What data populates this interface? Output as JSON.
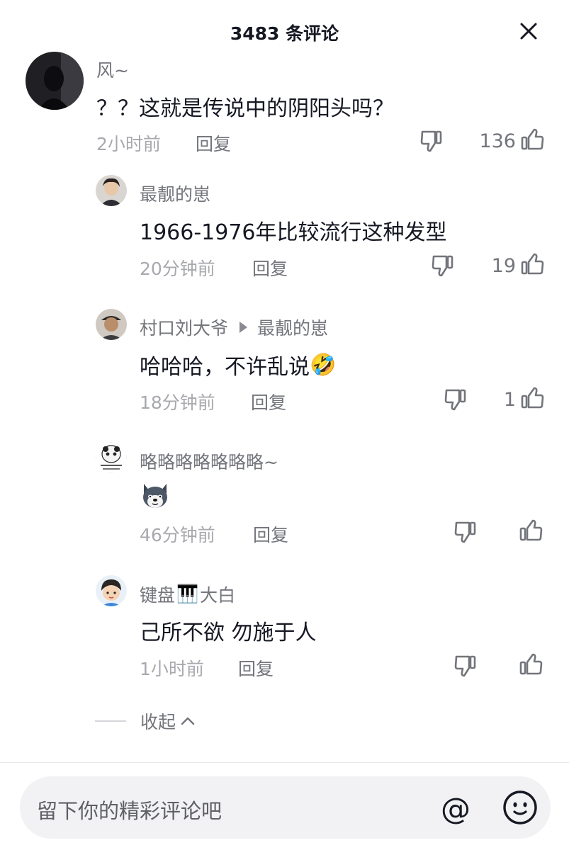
{
  "header": {
    "title": "3483 条评论",
    "close_icon": "close-icon"
  },
  "comments": [
    {
      "author": "风~",
      "text": "？？这就是传说中的阴阳头吗？",
      "time": "2小时前",
      "reply": "回复",
      "likes": "136"
    },
    {
      "author": "最靓的崽",
      "text": "1966-1976年比较流行这种发型",
      "time": "20分钟前",
      "reply": "回复",
      "likes": "19"
    },
    {
      "author": "村口刘大爷",
      "reply_to": "最靓的崽",
      "text": "哈哈哈，不许乱说",
      "emoji": "🤣",
      "time": "18分钟前",
      "reply": "回复",
      "likes": "1"
    },
    {
      "author": "略略略略略略略~",
      "text": "",
      "sticker": "dog-face-sticker",
      "time": "46分钟前",
      "reply": "回复",
      "likes": ""
    },
    {
      "author_part1": "键盘",
      "author_part2": "大白",
      "author_emoji": "🎹",
      "text": "己所不欲 勿施于人",
      "time": "1小时前",
      "reply": "回复",
      "likes": ""
    }
  ],
  "collapse": {
    "label": "收起"
  },
  "input": {
    "placeholder": "留下你的精彩评论吧",
    "at_icon": "at-icon",
    "at_symbol": "@",
    "emoji_icon": "emoji-icon"
  },
  "colors": {
    "text": "#161823",
    "secondary": "#73757b",
    "muted": "#a8a9ae",
    "input_bg": "#f2f2f4"
  }
}
